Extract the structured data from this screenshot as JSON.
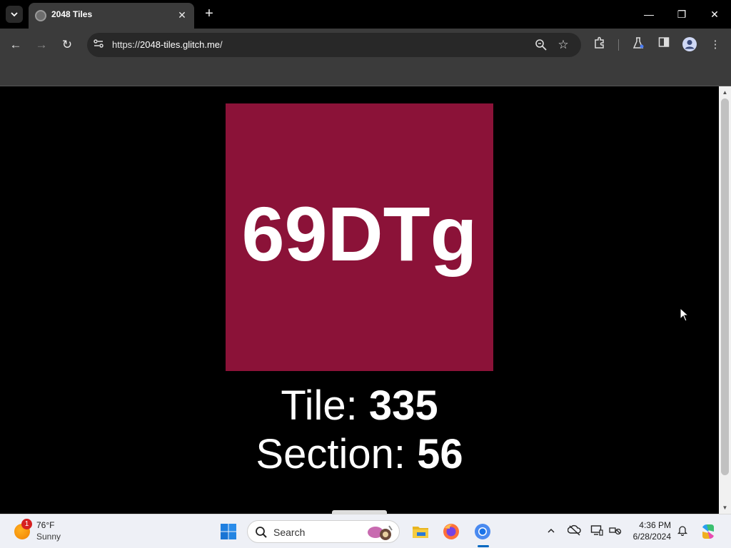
{
  "browser": {
    "tab_title": "2048 Tiles",
    "tab_close": "✕",
    "new_tab": "+",
    "url_scheme": "https://",
    "url_host": "2048-tiles.glitch.me",
    "url_path": "/",
    "window_controls": {
      "minimize": "—",
      "restore": "❐",
      "close": "✕"
    },
    "nav": {
      "back": "←",
      "forward": "→",
      "reload": "↻"
    }
  },
  "page": {
    "background": "#000000",
    "tile": {
      "text": "69DTg",
      "color": "#8b1238"
    },
    "tile_line": {
      "label": "Tile: ",
      "value": "335"
    },
    "section_line": {
      "label": "Section: ",
      "value": "56"
    }
  },
  "taskbar": {
    "weather": {
      "temp": "76°F",
      "condition": "Sunny",
      "badge": "1"
    },
    "search_label": "Search",
    "clock": {
      "time": "4:36 PM",
      "date": "6/28/2024"
    }
  }
}
